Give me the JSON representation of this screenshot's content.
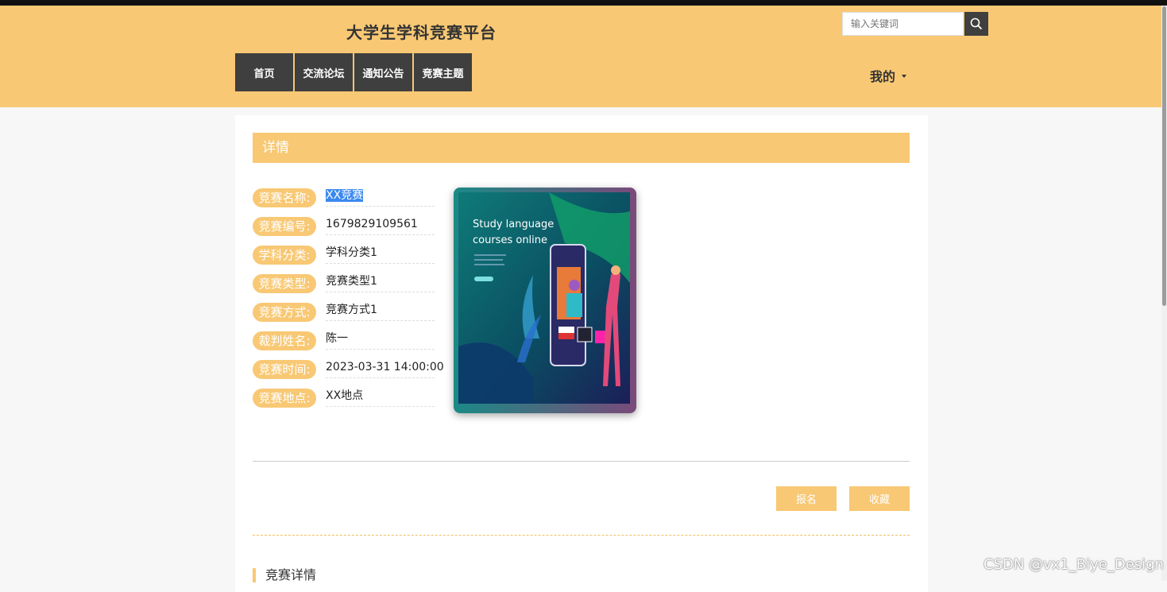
{
  "site": {
    "title": "大学生学科竞赛平台"
  },
  "search": {
    "placeholder": "输入关键词"
  },
  "nav": {
    "items": [
      "首页",
      "交流论坛",
      "通知公告",
      "竞赛主题"
    ]
  },
  "user_menu": {
    "label": "我的"
  },
  "detail": {
    "heading": "详情",
    "fields": [
      {
        "label": "竞赛名称:",
        "value": "XX竞赛"
      },
      {
        "label": "竞赛编号:",
        "value": "1679829109561"
      },
      {
        "label": "学科分类:",
        "value": "学科分类1"
      },
      {
        "label": "竞赛类型:",
        "value": "竞赛类型1"
      },
      {
        "label": "竞赛方式:",
        "value": "竞赛方式1"
      },
      {
        "label": "裁判姓名:",
        "value": "陈一"
      },
      {
        "label": "竞赛时间:",
        "value": "2023-03-31 14:00:00"
      },
      {
        "label": "竞赛地点:",
        "value": "XX地点"
      }
    ],
    "cover_text": {
      "line1": "Study language",
      "line2": "courses online"
    }
  },
  "actions": {
    "signup": "报名",
    "favorite": "收藏"
  },
  "section": {
    "title": "竞赛详情"
  },
  "watermark": "CSDN @vx1_Biye_Design",
  "colors": {
    "accent": "#f8c874",
    "nav_bg": "#3f3f3f",
    "selection": "#3b89ef"
  }
}
